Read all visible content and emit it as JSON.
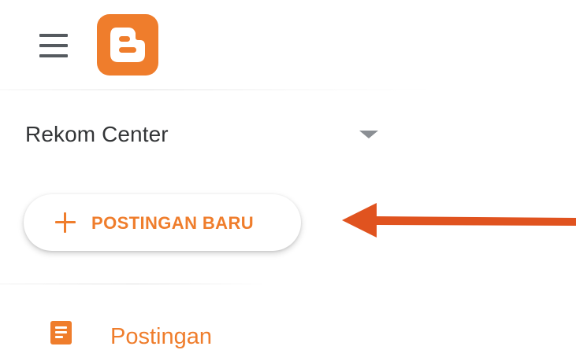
{
  "header": {
    "menu_icon": "hamburger-menu-icon",
    "logo_icon": "blogger-logo-icon"
  },
  "blog_selector": {
    "name": "Rekom Center",
    "dropdown_icon": "dropdown-triangle-icon"
  },
  "new_post_button": {
    "label": "POSTINGAN BARU",
    "icon": "plus-icon"
  },
  "annotation": {
    "arrow_icon": "pointer-arrow-icon",
    "arrow_color": "#e0531f"
  },
  "nav": {
    "items": [
      {
        "label": "Postingan",
        "icon": "document-icon"
      }
    ]
  },
  "colors": {
    "accent": "#ef7d2c",
    "text": "#333537",
    "icon_gray": "#555a5f"
  }
}
